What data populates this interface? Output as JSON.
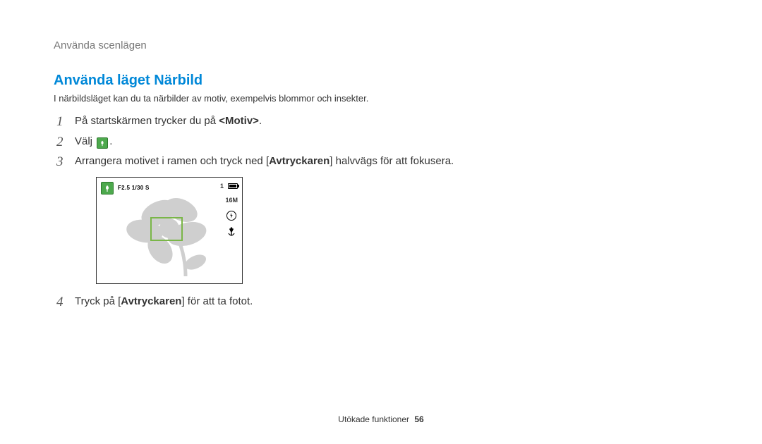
{
  "breadcrumb": "Använda scenlägen",
  "section_title": "Använda läget Närbild",
  "intro": "I närbildsläget kan du ta närbilder av motiv, exempelvis blommor och insekter.",
  "steps": {
    "s1": {
      "num": "1",
      "pre": "På startskärmen trycker du på ",
      "bold": "<Motiv>",
      "post": "."
    },
    "s2": {
      "num": "2",
      "pre": "Välj ",
      "post": "."
    },
    "s3": {
      "num": "3",
      "pre": "Arrangera motivet i ramen och tryck ned [",
      "bold": "Avtryckaren",
      "post": "] halvvägs för att fokusera."
    },
    "s4": {
      "num": "4",
      "pre": "Tryck på [",
      "bold": "Avtryckaren",
      "post": "] för att ta fotot."
    }
  },
  "camera": {
    "exposure": "F2.5 1/30 S",
    "count": "1",
    "size_label": "16M"
  },
  "footer": {
    "label": "Utökade funktioner",
    "page": "56"
  }
}
